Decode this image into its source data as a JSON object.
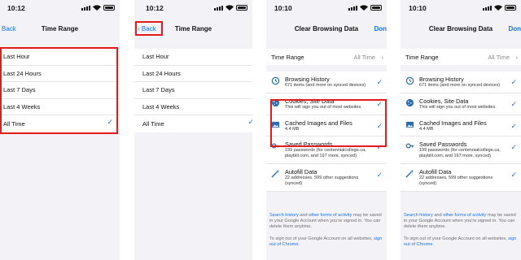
{
  "status_time": [
    "10:12",
    "10:12",
    "10:10",
    "10:10"
  ],
  "panels": {
    "p1": {
      "back": "Back",
      "title": "Time Range",
      "options": [
        "Last Hour",
        "Last 24 Hours",
        "Last 7 Days",
        "Last 4 Weeks",
        "All Time"
      ]
    },
    "p2": {
      "back": "Back",
      "title": "Time Range",
      "options": [
        "Last Hour",
        "Last 24 Hours",
        "Last 7 Days",
        "Last 4 Weeks",
        "All Time"
      ]
    },
    "p3": {
      "title": "Clear Browsing Data",
      "done": "Don"
    },
    "p4": {
      "title": "Clear Browsing Data",
      "done": "Don"
    }
  },
  "selected_range": "All Time",
  "time_range": {
    "label": "Time Range",
    "value": "All Time"
  },
  "data_items": [
    {
      "title": "Browsing History",
      "sub": "671 items (and more on synced devices)",
      "icon": "history-icon",
      "checked": true
    },
    {
      "title": "Cookies, Site Data",
      "sub": "This will sign you out of most websites.",
      "icon": "cookie-icon",
      "checked": true
    },
    {
      "title": "Cached Images and Files",
      "sub": "4.4 MB",
      "icon": "image-icon",
      "checked": true
    },
    {
      "title": "Saved Passwords",
      "sub": "199 passwords (for centennialcollege.ca, playbill.com, and 197 more, synced)",
      "icon": "key-icon",
      "checked": true
    },
    {
      "title": "Autofill Data",
      "sub": "22 addresses, 599 other suggestions (synced)",
      "icon": "autofill-icon",
      "checked": true
    }
  ],
  "footer": {
    "link1": "Search history",
    "and": " and ",
    "link2": "other forms of activity",
    "rest": " may be saved in your Google Account when you're signed in. You can delete them anytime.",
    "signout": "To sign out of your Google Account on all websites, ",
    "link3": "sign out of Chrome."
  },
  "colors": {
    "accent": "#1a73e8",
    "highlight": "#e21b1b",
    "background": "#f2f2f7"
  }
}
